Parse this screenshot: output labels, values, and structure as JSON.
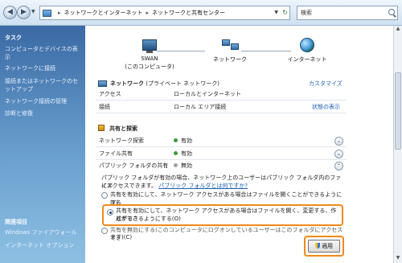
{
  "address": {
    "breadcrumbs": [
      "ネットワークとインターネット",
      "ネットワークと共有センター"
    ],
    "separator": "▸",
    "search_placeholder": "検索"
  },
  "sidebar": {
    "tasks_heading": "タスク",
    "items": [
      {
        "label": "コンピュータとデバイスの表示"
      },
      {
        "label": "ネットワークに接続"
      },
      {
        "label": "接続またはネットワークのセットアップ"
      },
      {
        "label": "ネットワーク接続の管理"
      },
      {
        "label": "診断と修復"
      }
    ],
    "related_heading": "関連項目",
    "related_items": [
      {
        "label": "Windows ファイアウォール"
      },
      {
        "label": "インターネット オプション"
      }
    ]
  },
  "map": {
    "computer_label": "SWAN",
    "computer_sub": "(このコンピュータ)",
    "network_label": "ネットワーク",
    "internet_label": "インターネット"
  },
  "network": {
    "title": "ネットワーク",
    "title_suffix": "(プライベート ネットワーク)",
    "customize": "カスタマイズ",
    "rows": [
      {
        "label": "アクセス",
        "value": "ローカルとインターネット"
      },
      {
        "label": "接続",
        "value": "ローカル エリア接続",
        "action": "状態の表示"
      }
    ]
  },
  "sharing": {
    "heading": "共有と探索",
    "rows": [
      {
        "label": "ネットワーク探索",
        "value": "有効"
      },
      {
        "label": "ファイル共有",
        "value": "有効"
      },
      {
        "label": "パブリック フォルダの共有",
        "value": "無効"
      }
    ],
    "panel": {
      "description_1": "パブリック フォルダが有効の場合、ネットワーク上のユーザーはパブリック フォルダ内のファイル",
      "description_2": "にアクセスできます。",
      "help_link": "パブリック フォルダとは何ですか?",
      "option_1": "共有を有効にして、ネットワーク アクセスがある場合はファイルを開くことができるようにする",
      "option_1_tail": "(Y)",
      "option_2_line1": "共有を有効にして、ネットワーク アクセスがある場合はファイルを開く、変更する、作成するこ",
      "option_2_line2": "とができるようにする(O)",
      "option_3_line1": "共有を無効にする(このコンピュータにログオンしているユーザーはこのフォルダにアクセスでき",
      "option_3_line2": "ます)(C)",
      "selected_option": 2,
      "apply_label": "適用"
    }
  },
  "colors": {
    "highlight": "#f08a1a",
    "enabled_dot": "#3c9a3a",
    "disabled_dot": "#9aa0a6",
    "link": "#1a5fb4"
  }
}
